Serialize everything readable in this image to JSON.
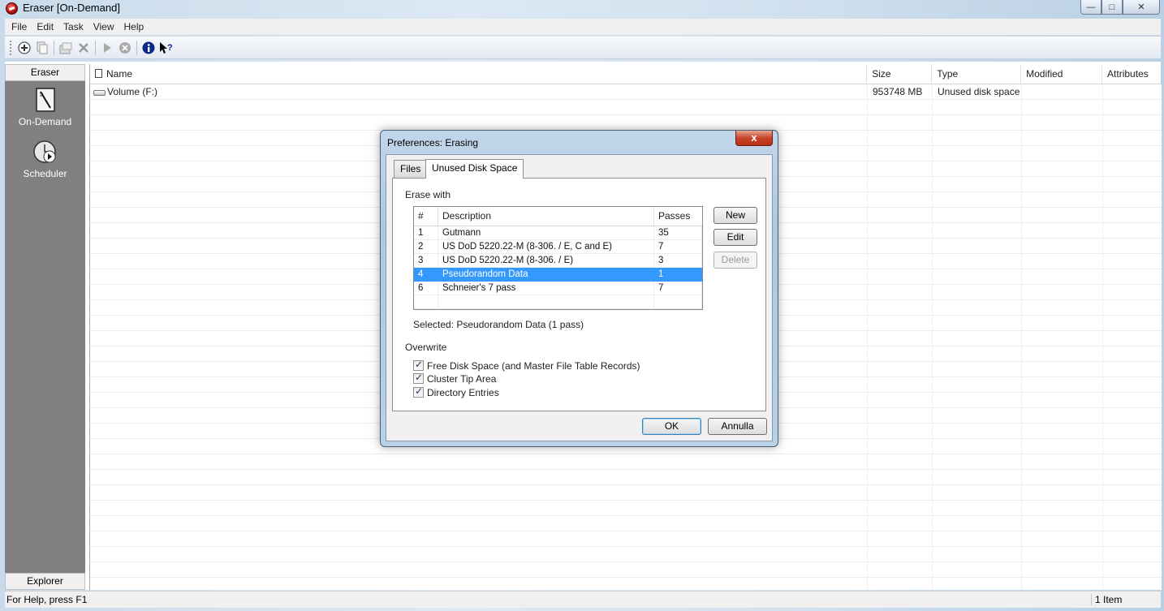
{
  "window": {
    "title": "Eraser  [On-Demand]",
    "controls": {
      "minimize": "—",
      "maximize": "□",
      "close": "✕"
    }
  },
  "menu": [
    "File",
    "Edit",
    "Task",
    "View",
    "Help"
  ],
  "toolbar": {
    "icons": [
      "new-task-icon",
      "copy-icon",
      "properties-icon",
      "delete-icon",
      "run-icon",
      "stop-icon",
      "info-icon",
      "help-pointer-icon"
    ]
  },
  "sidebar": {
    "header": "Eraser",
    "items": [
      {
        "label": "On-Demand",
        "icon": "on-demand-icon"
      },
      {
        "label": "Scheduler",
        "icon": "scheduler-icon"
      }
    ],
    "footer": "Explorer"
  },
  "list": {
    "columns": [
      "Name",
      "Size",
      "Type",
      "Modified",
      "Attributes"
    ],
    "rows": [
      {
        "name": "Volume (F:)",
        "size": "953748 MB",
        "type": "Unused disk space",
        "modified": "",
        "attributes": ""
      }
    ]
  },
  "status": {
    "help": "For Help, press F1",
    "count": "1 Item"
  },
  "dialog": {
    "title": "Preferences: Erasing",
    "close": "x",
    "tabs": [
      "Files",
      "Unused Disk Space"
    ],
    "active_tab": "Unused Disk Space",
    "erase_with_label": "Erase with",
    "scheme_columns": [
      "#",
      "Description",
      "Passes"
    ],
    "schemes": [
      {
        "num": "1",
        "desc": "Gutmann",
        "passes": "35"
      },
      {
        "num": "2",
        "desc": "US DoD 5220.22-M (8-306. / E, C and E)",
        "passes": "7"
      },
      {
        "num": "3",
        "desc": "US DoD 5220.22-M (8-306. / E)",
        "passes": "3"
      },
      {
        "num": "4",
        "desc": "Pseudorandom Data",
        "passes": "1"
      },
      {
        "num": "6",
        "desc": "Schneier's 7 pass",
        "passes": "7"
      }
    ],
    "selected_index": 3,
    "selected_text": "Selected: Pseudorandom Data (1 pass)",
    "buttons": {
      "new": "New",
      "edit": "Edit",
      "delete": "Delete"
    },
    "overwrite_label": "Overwrite",
    "overwrite_options": [
      {
        "label": "Free Disk Space (and Master File Table Records)",
        "checked": true
      },
      {
        "label": "Cluster Tip Area",
        "checked": true
      },
      {
        "label": "Directory Entries",
        "checked": true
      }
    ],
    "ok": "OK",
    "cancel": "Annulla"
  }
}
